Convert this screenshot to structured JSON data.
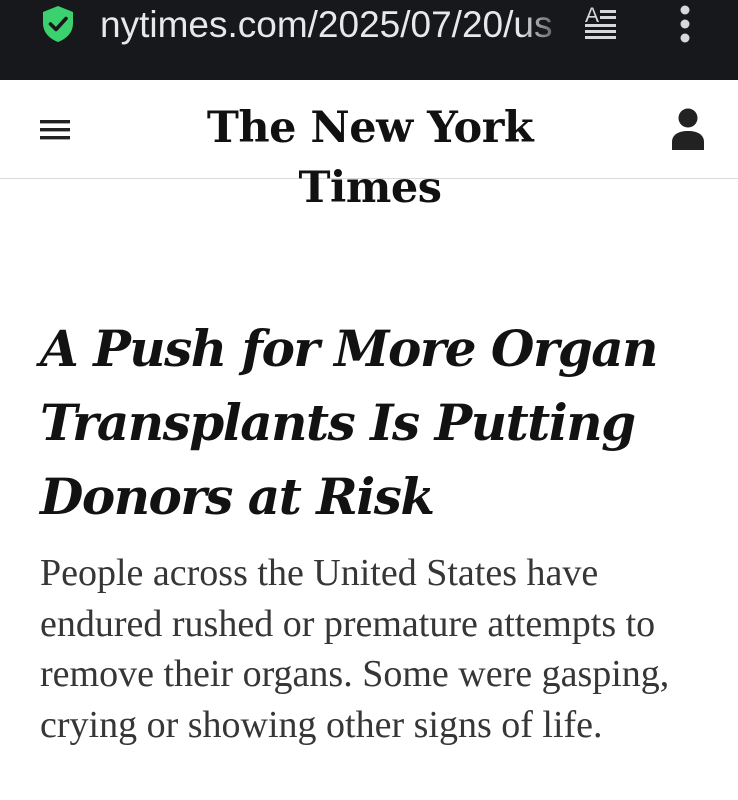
{
  "browser": {
    "url": "nytimes.com/2025/07/20/us",
    "icons": {
      "security": "shield-check-icon",
      "reader": "reader-mode-icon",
      "menu": "vertical-dots-icon"
    },
    "colors": {
      "bar": "#17181c",
      "shield": "#3bd16f",
      "text": "#e8e8ea"
    }
  },
  "site": {
    "logo_text": "The New York Times",
    "icons": {
      "menu": "hamburger-menu-icon",
      "account": "account-person-icon"
    }
  },
  "article": {
    "headline": "A Push for More Organ Transplants Is Putting Donors at Risk",
    "summary": "People across the United States have endured rushed or premature attempts to remove their organs. Some were gasping, crying or showing other signs of life."
  }
}
